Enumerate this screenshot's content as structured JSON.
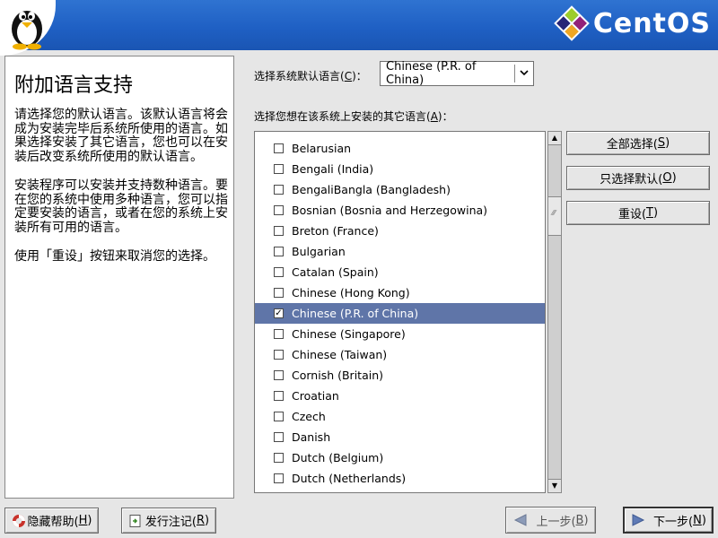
{
  "brand": {
    "name": "CentOS"
  },
  "help": {
    "title": "附加语言支持",
    "paragraphs": [
      "请选择您的默认语言。该默认语言将会成为安装完毕后系统所使用的语言。如果选择安装了其它语言，您也可以在安装后改变系统所使用的默认语言。",
      "安装程序可以安装并支持数种语言。要在您的系统中使用多种语言，您可以指定要安装的语言，或者在您的系统上安装所有可用的语言。",
      "使用「重设」按钮来取消您的选择。"
    ]
  },
  "default_language": {
    "label_before": "选择系统默认语言(",
    "mnemonic": "C",
    "label_after": ")：",
    "selected": "Chinese (P.R. of China)"
  },
  "other_languages": {
    "label_before": "选择您想在该系统上安装的其它语言(",
    "mnemonic": "A",
    "label_after": ")：",
    "items": [
      {
        "label": "Belarusian",
        "checked": false
      },
      {
        "label": "Bengali (India)",
        "checked": false
      },
      {
        "label": "BengaliBangla (Bangladesh)",
        "checked": false
      },
      {
        "label": "Bosnian (Bosnia and Herzegowina)",
        "checked": false
      },
      {
        "label": "Breton (France)",
        "checked": false
      },
      {
        "label": "Bulgarian",
        "checked": false
      },
      {
        "label": "Catalan (Spain)",
        "checked": false
      },
      {
        "label": "Chinese (Hong Kong)",
        "checked": false
      },
      {
        "label": "Chinese (P.R. of China)",
        "checked": true,
        "selected": true
      },
      {
        "label": "Chinese (Singapore)",
        "checked": false
      },
      {
        "label": "Chinese (Taiwan)",
        "checked": false
      },
      {
        "label": "Cornish (Britain)",
        "checked": false
      },
      {
        "label": "Croatian",
        "checked": false
      },
      {
        "label": "Czech",
        "checked": false
      },
      {
        "label": "Danish",
        "checked": false
      },
      {
        "label": "Dutch (Belgium)",
        "checked": false
      },
      {
        "label": "Dutch (Netherlands)",
        "checked": false
      }
    ]
  },
  "side_buttons": {
    "select_all": {
      "before": "全部选择(",
      "mnemonic": "S",
      "after": ")"
    },
    "select_default": {
      "before": "只选择默认(",
      "mnemonic": "O",
      "after": ")"
    },
    "reset": {
      "before": "重设(",
      "mnemonic": "T",
      "after": ")"
    }
  },
  "bottom_buttons": {
    "hide_help": {
      "before": "隐藏帮助(",
      "mnemonic": "H",
      "after": ")",
      "icon": "lifebuoy-icon"
    },
    "release_notes": {
      "before": "发行注记(",
      "mnemonic": "R",
      "after": ")",
      "icon": "release-notes-icon"
    },
    "back": {
      "before": "上一步(",
      "mnemonic": "B",
      "after": ")",
      "icon": "arrow-left-icon"
    },
    "next": {
      "before": "下一步(",
      "mnemonic": "N",
      "after": ")",
      "icon": "arrow-right-icon"
    }
  },
  "colors": {
    "header_blue": "#1f60c4",
    "selection": "#5f75a8"
  }
}
